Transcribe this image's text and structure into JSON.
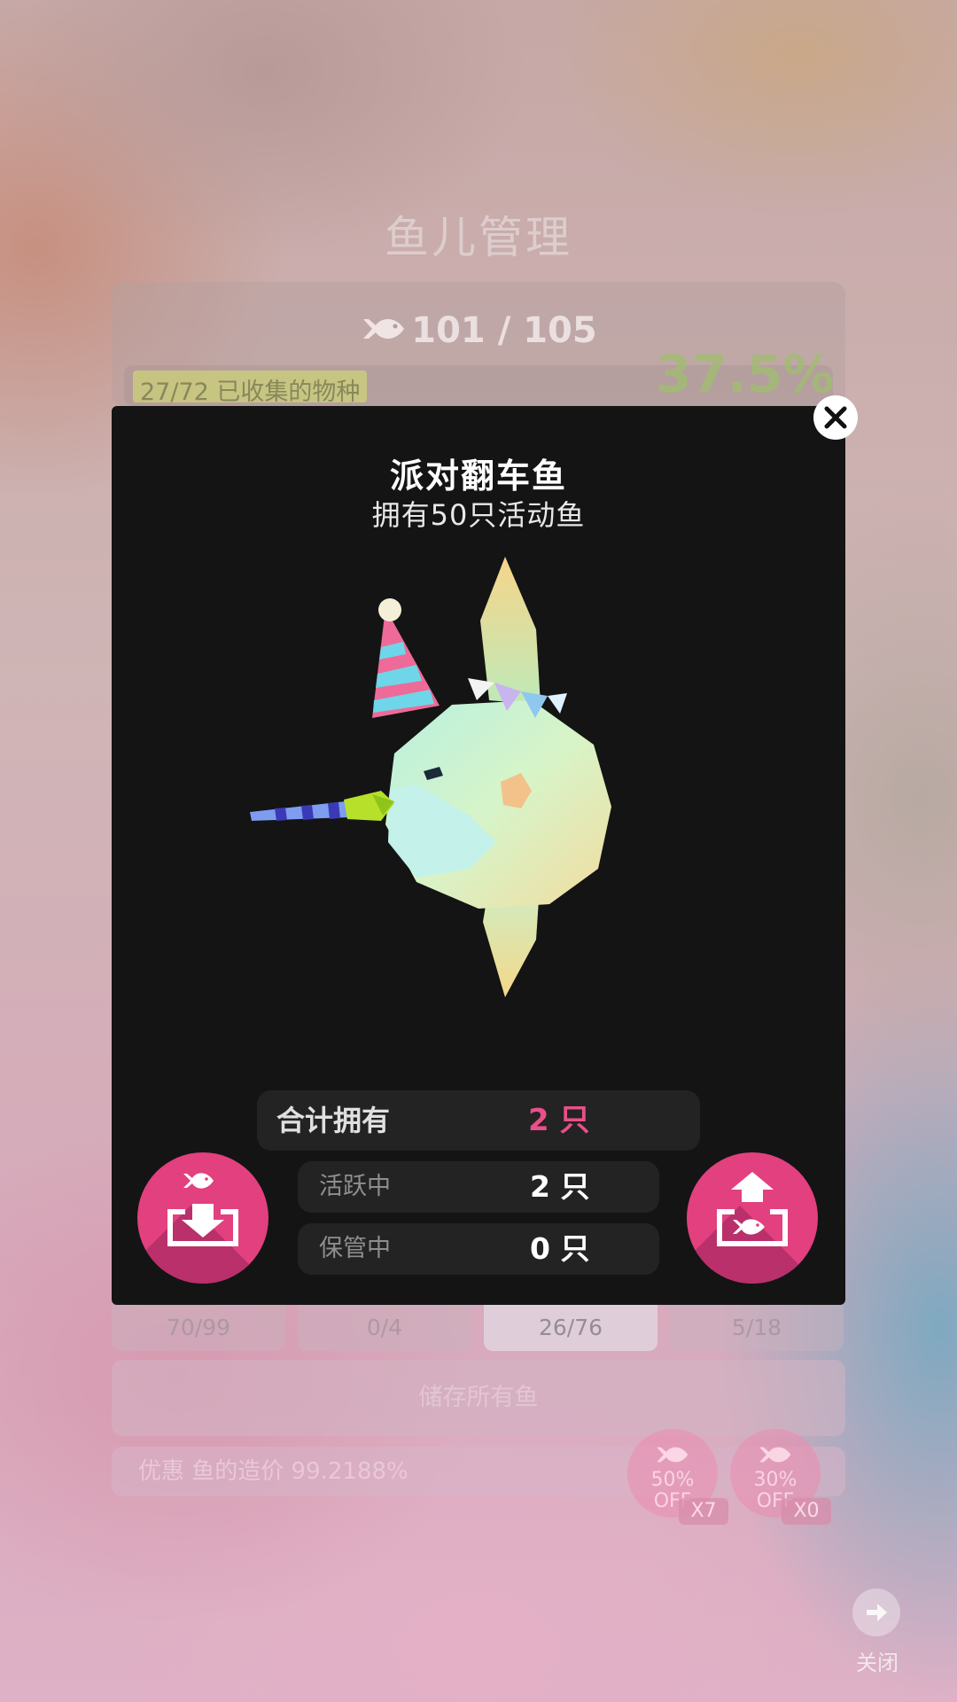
{
  "background": {
    "title": "鱼儿管理",
    "fish_count": "101 / 105",
    "collected": "27/72 已收集的物种",
    "percent": "37.5%",
    "tabs": [
      "70/99",
      "0/4",
      "26/76",
      "5/18"
    ],
    "store_all": "储存所有鱼",
    "discount_text": "优惠 鱼的造价 99.2188%",
    "coupons": [
      {
        "label": "50%\nOFF",
        "count": "X7"
      },
      {
        "label": "30%\nOFF",
        "count": "X0"
      }
    ],
    "close_label": "关闭"
  },
  "modal": {
    "name": "派对翻车鱼",
    "subtitle": "拥有50只活动鱼",
    "total_label": "合计拥有",
    "total_value": "2 只",
    "active_label": "活跃中",
    "active_value": "2 只",
    "stored_label": "保管中",
    "stored_value": "0 只"
  },
  "colors": {
    "accent": "#e2407e",
    "accent_text": "#e94f8a",
    "modal_bg": "#141414",
    "stat_bg": "#232323"
  },
  "icons": {
    "modal_close": "close-icon",
    "store": "fish-store-icon",
    "release": "fish-release-icon",
    "bottom_close": "arrow-right-icon"
  }
}
